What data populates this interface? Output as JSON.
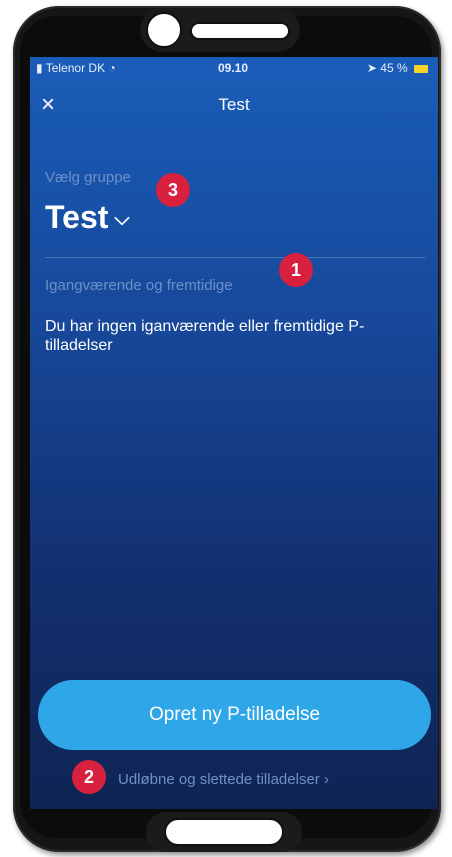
{
  "status_bar": {
    "carrier": "Telenor DK",
    "time": "09.10",
    "battery": "45 %"
  },
  "header": {
    "title": "Test",
    "close_icon": "×"
  },
  "group": {
    "label": "Vælg gruppe",
    "value": "Test",
    "chevron": "⌵"
  },
  "section": {
    "label": "Igangværende og fremtidige",
    "empty_text": "Du har ingen iganværende eller fremtidige P-tilladelser"
  },
  "actions": {
    "primary_label": "Opret ny P-tilladelse",
    "link_label": "Udløbne og slettede tilladelser",
    "link_chevron": "›"
  },
  "annotations": [
    "1",
    "2",
    "3"
  ],
  "colors": {
    "accent_button": "#2ea6e8",
    "badge": "#d8203f",
    "muted_text": "#6e90c8"
  }
}
